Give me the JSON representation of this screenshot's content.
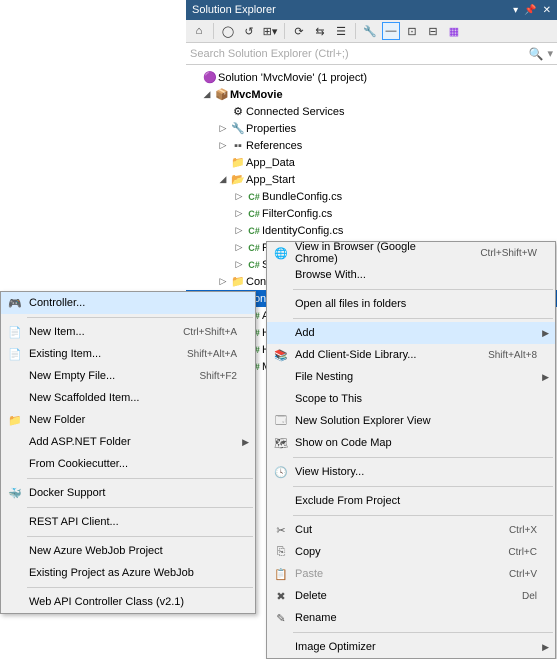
{
  "pane": {
    "title": "Solution Explorer"
  },
  "search": {
    "placeholder": "Search Solution Explorer (Ctrl+;)"
  },
  "tree": {
    "solution": "Solution 'MvcMovie' (1 project)",
    "project": "MvcMovie",
    "connected": "Connected Services",
    "properties": "Properties",
    "references": "References",
    "appdata": "App_Data",
    "appstart": "App_Start",
    "files": {
      "bundle": "BundleConfig.cs",
      "filter": "FilterConfig.cs",
      "identity": "IdentityConfig.cs",
      "route": "RouteConfig.cs",
      "startup": "Startup.Auth.cs"
    },
    "content": "Content",
    "controllers": "Contro",
    "children": {
      "acc": "Acc",
      "hel": "Hel",
      "hol": "Ho",
      "ma": "Ma"
    }
  },
  "ctx": {
    "viewBrowser": "View in Browser (Google Chrome)",
    "viewBrowserKey": "Ctrl+Shift+W",
    "browseWith": "Browse With...",
    "openAll": "Open all files in folders",
    "add": "Add",
    "addClient": "Add Client-Side Library...",
    "addClientKey": "Shift+Alt+8",
    "fileNesting": "File Nesting",
    "scope": "Scope to This",
    "newView": "New Solution Explorer View",
    "codeMap": "Show on Code Map",
    "viewHistory": "View History...",
    "exclude": "Exclude From Project",
    "cut": "Cut",
    "cutKey": "Ctrl+X",
    "copy": "Copy",
    "copyKey": "Ctrl+C",
    "paste": "Paste",
    "pasteKey": "Ctrl+V",
    "delete": "Delete",
    "deleteKey": "Del",
    "rename": "Rename",
    "imgOpt": "Image Optimizer"
  },
  "sub": {
    "controller": "Controller...",
    "newItem": "New Item...",
    "newItemKey": "Ctrl+Shift+A",
    "existingItem": "Existing Item...",
    "existingItemKey": "Shift+Alt+A",
    "newEmpty": "New Empty File...",
    "newEmptyKey": "Shift+F2",
    "scaffold": "New Scaffolded Item...",
    "newFolder": "New Folder",
    "aspFolder": "Add ASP.NET Folder",
    "cookie": "From Cookiecutter...",
    "docker": "Docker Support",
    "rest": "REST API Client...",
    "azure": "New Azure WebJob Project",
    "existingAzure": "Existing Project as Azure WebJob",
    "webapi": "Web API Controller Class (v2.1)"
  }
}
